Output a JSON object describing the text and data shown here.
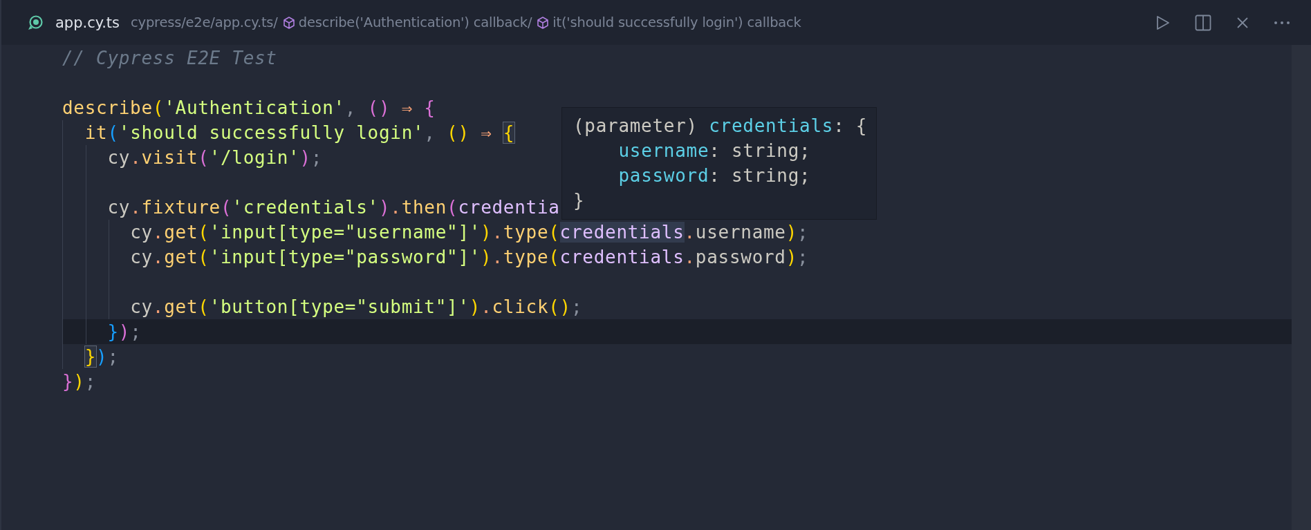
{
  "tab": {
    "file_name": "app.cy.ts",
    "breadcrumbs": [
      {
        "text": "cypress/e2e/app.cy.ts/",
        "kind": "folder"
      },
      {
        "text": "describe('Authentication') callback/",
        "kind": "symbol"
      },
      {
        "text": "it('should successfully login') callback",
        "kind": "symbol"
      }
    ]
  },
  "code_lines": [
    {
      "kind": "code",
      "current": false,
      "tokens": [
        {
          "kind": "comment",
          "text": "// Cypress E2E Test"
        }
      ]
    },
    {
      "kind": "blank"
    },
    {
      "kind": "code",
      "current": false,
      "tokens": [
        {
          "kind": "func",
          "text": "describe"
        },
        {
          "kind": "paren1",
          "text": "("
        },
        {
          "kind": "string",
          "text": "'Authentication'"
        },
        {
          "kind": "punct",
          "text": ", "
        },
        {
          "kind": "paren2",
          "text": "()"
        },
        {
          "kind": "op",
          "text": " ⇒ "
        },
        {
          "kind": "paren2",
          "text": "{"
        }
      ]
    },
    {
      "kind": "code",
      "current": false,
      "tokens": [
        {
          "kind": "func",
          "text": "  it"
        },
        {
          "kind": "paren3",
          "text": "("
        },
        {
          "kind": "string",
          "text": "'should successfully login'"
        },
        {
          "kind": "punct",
          "text": ", "
        },
        {
          "kind": "paren1",
          "text": "()"
        },
        {
          "kind": "op",
          "text": " ⇒ "
        },
        {
          "kind": "paren1",
          "text": "{",
          "highlighted": true
        }
      ]
    },
    {
      "kind": "code",
      "current": false,
      "tokens": [
        {
          "kind": "plain",
          "text": "    cy"
        },
        {
          "kind": "op",
          "text": "."
        },
        {
          "kind": "func",
          "text": "visit"
        },
        {
          "kind": "paren2",
          "text": "("
        },
        {
          "kind": "string",
          "text": "'/login'"
        },
        {
          "kind": "paren2",
          "text": ")"
        },
        {
          "kind": "punct",
          "text": ";"
        }
      ]
    },
    {
      "kind": "blank"
    },
    {
      "kind": "code",
      "current": false,
      "tokens": [
        {
          "kind": "plain",
          "text": "    cy"
        },
        {
          "kind": "op",
          "text": "."
        },
        {
          "kind": "func",
          "text": "fixture"
        },
        {
          "kind": "paren2",
          "text": "("
        },
        {
          "kind": "string",
          "text": "'credentials'"
        },
        {
          "kind": "paren2",
          "text": ")"
        },
        {
          "kind": "op",
          "text": "."
        },
        {
          "kind": "func",
          "text": "then"
        },
        {
          "kind": "paren2",
          "text": "("
        },
        {
          "kind": "param",
          "text": "credentia"
        }
      ]
    },
    {
      "kind": "code",
      "current": false,
      "tokens": [
        {
          "kind": "plain",
          "text": "      cy"
        },
        {
          "kind": "op",
          "text": "."
        },
        {
          "kind": "func",
          "text": "get"
        },
        {
          "kind": "paren1",
          "text": "("
        },
        {
          "kind": "string",
          "text": "'input[type=\"username\"]'"
        },
        {
          "kind": "paren1",
          "text": ")"
        },
        {
          "kind": "op",
          "text": "."
        },
        {
          "kind": "func",
          "text": "type"
        },
        {
          "kind": "paren1",
          "text": "("
        },
        {
          "kind": "param",
          "text": "credentials",
          "highlighted": true
        },
        {
          "kind": "op",
          "text": "."
        },
        {
          "kind": "plain",
          "text": "username"
        },
        {
          "kind": "paren1",
          "text": ")"
        },
        {
          "kind": "punct",
          "text": ";"
        }
      ]
    },
    {
      "kind": "code",
      "current": false,
      "tokens": [
        {
          "kind": "plain",
          "text": "      cy"
        },
        {
          "kind": "op",
          "text": "."
        },
        {
          "kind": "func",
          "text": "get"
        },
        {
          "kind": "paren1",
          "text": "("
        },
        {
          "kind": "string",
          "text": "'input[type=\"password\"]'"
        },
        {
          "kind": "paren1",
          "text": ")"
        },
        {
          "kind": "op",
          "text": "."
        },
        {
          "kind": "func",
          "text": "type"
        },
        {
          "kind": "paren1",
          "text": "("
        },
        {
          "kind": "param",
          "text": "credentials"
        },
        {
          "kind": "op",
          "text": "."
        },
        {
          "kind": "plain",
          "text": "password"
        },
        {
          "kind": "paren1",
          "text": ")"
        },
        {
          "kind": "punct",
          "text": ";"
        }
      ]
    },
    {
      "kind": "blank"
    },
    {
      "kind": "code",
      "current": false,
      "tokens": [
        {
          "kind": "plain",
          "text": "      cy"
        },
        {
          "kind": "op",
          "text": "."
        },
        {
          "kind": "func",
          "text": "get"
        },
        {
          "kind": "paren1",
          "text": "("
        },
        {
          "kind": "string",
          "text": "'button[type=\"submit\"]'"
        },
        {
          "kind": "paren1",
          "text": ")"
        },
        {
          "kind": "op",
          "text": "."
        },
        {
          "kind": "func",
          "text": "click"
        },
        {
          "kind": "paren1",
          "text": "()"
        },
        {
          "kind": "punct",
          "text": ";"
        }
      ]
    },
    {
      "kind": "code",
      "current": true,
      "tokens": [
        {
          "kind": "paren3",
          "text": "    }"
        },
        {
          "kind": "paren2",
          "text": ")"
        },
        {
          "kind": "punct",
          "text": ";"
        }
      ]
    },
    {
      "kind": "code",
      "current": false,
      "tokens": [
        {
          "kind": "paren1",
          "text": "  }",
          "highlighted": true
        },
        {
          "kind": "paren3",
          "text": ")"
        },
        {
          "kind": "punct",
          "text": ";"
        }
      ]
    },
    {
      "kind": "code",
      "current": false,
      "tokens": [
        {
          "kind": "paren2",
          "text": "}"
        },
        {
          "kind": "paren1",
          "text": ")"
        },
        {
          "kind": "punct",
          "text": ";"
        }
      ]
    }
  ],
  "hover_tooltip": {
    "lines": [
      {
        "tokens": [
          {
            "kind": "plain",
            "text": "(parameter) "
          },
          {
            "kind": "name",
            "text": "credentials"
          },
          {
            "kind": "plain",
            "text": ": {"
          }
        ]
      },
      {
        "tokens": [
          {
            "kind": "name",
            "text": "    username"
          },
          {
            "kind": "plain",
            "text": ": string;"
          }
        ]
      },
      {
        "tokens": [
          {
            "kind": "name",
            "text": "    password"
          },
          {
            "kind": "plain",
            "text": ": string;"
          }
        ]
      },
      {
        "tokens": [
          {
            "kind": "plain",
            "text": "}"
          }
        ]
      }
    ]
  }
}
